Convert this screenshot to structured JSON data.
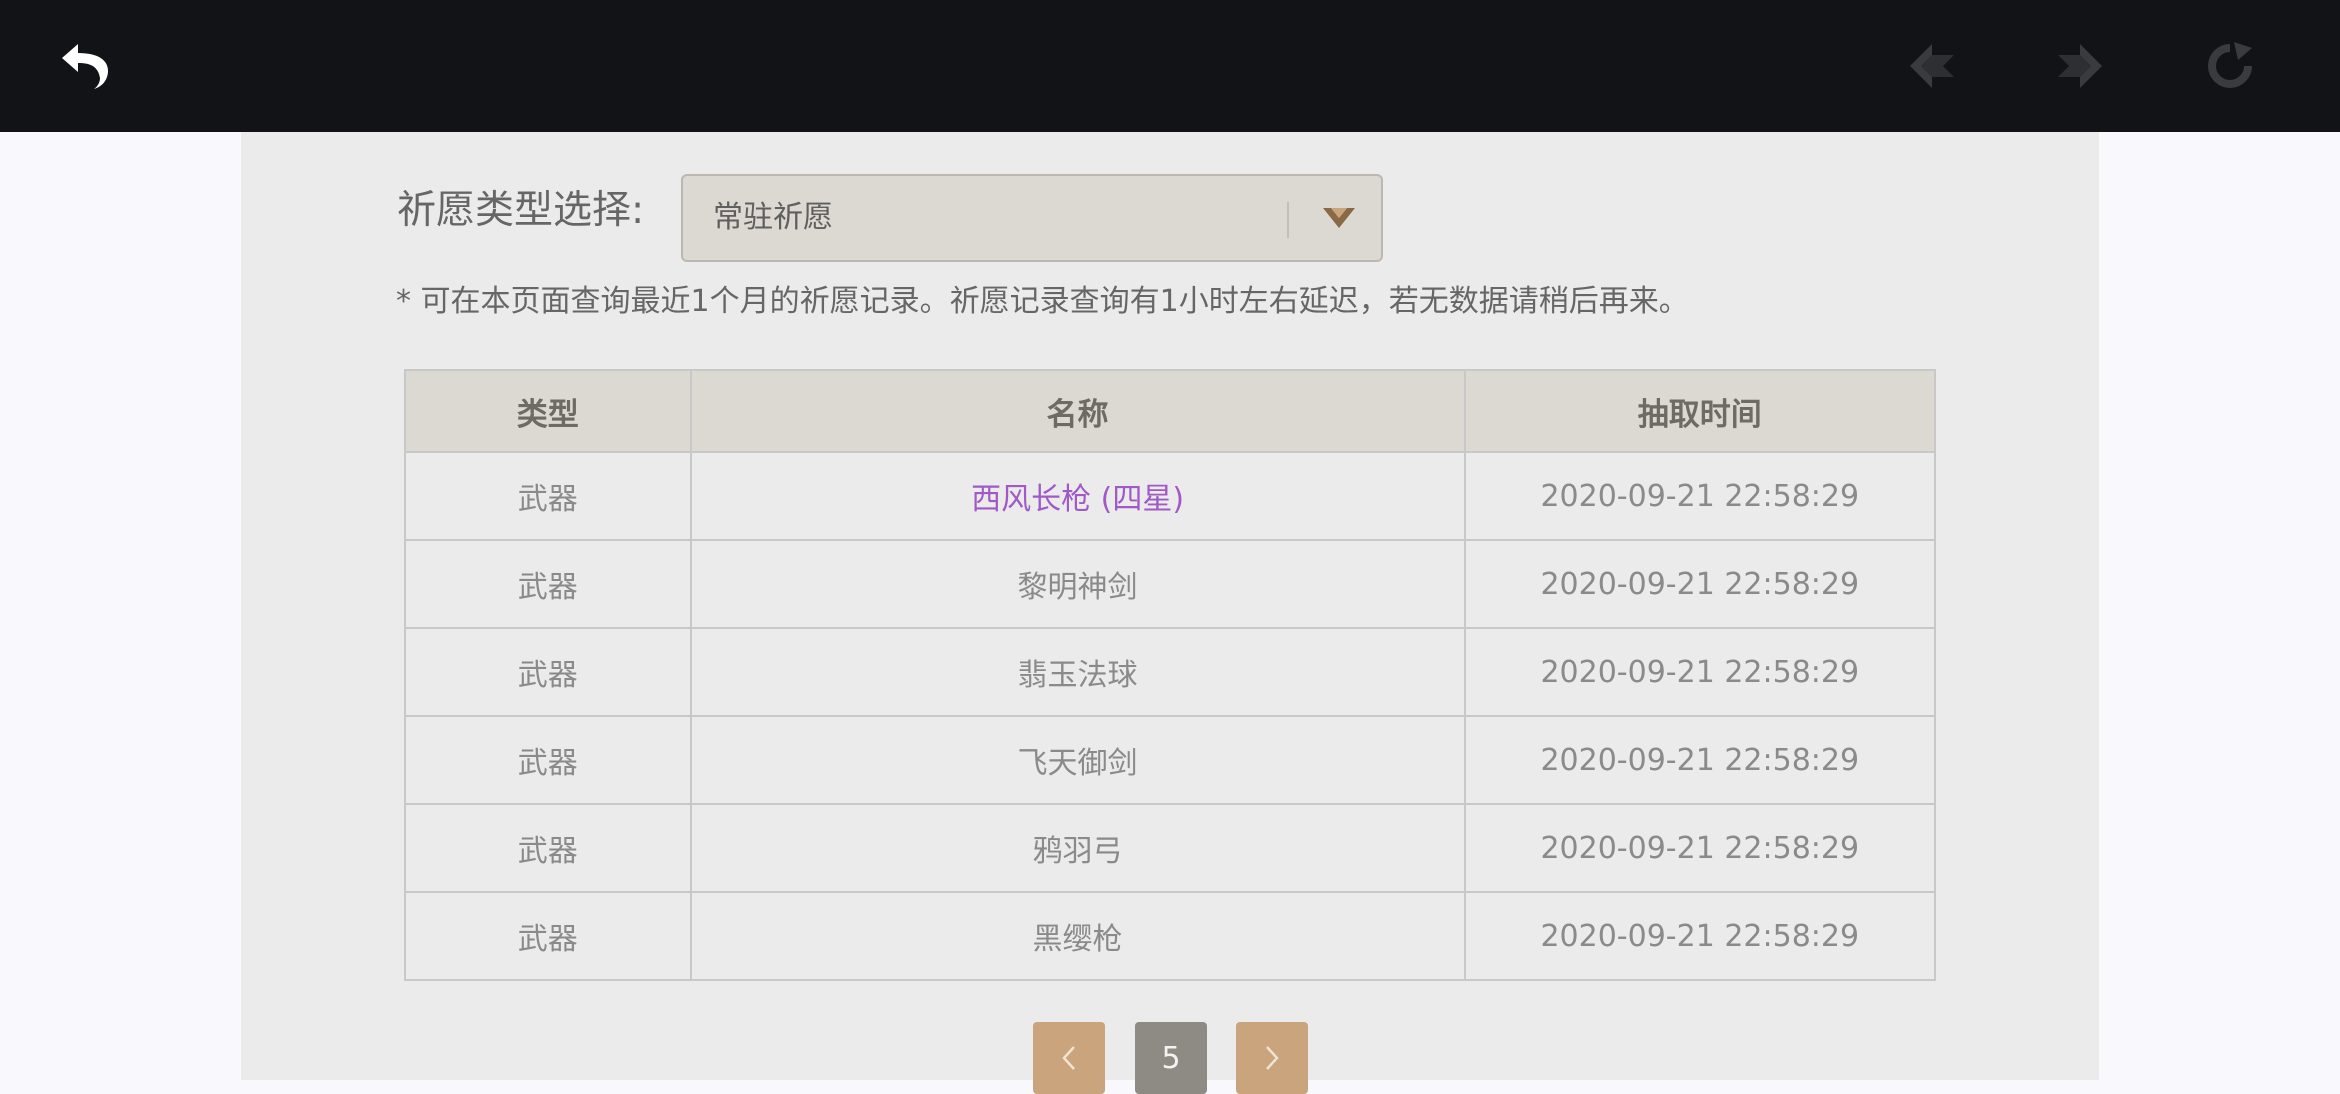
{
  "topbar": {
    "icons": [
      "back-arrow-icon",
      "prev-icon",
      "next-icon",
      "reload-icon"
    ],
    "colors": {
      "background": "#121316",
      "icon_active": "#ffffff",
      "icon_disabled": "#3a3b3f"
    }
  },
  "filter": {
    "label": "祈愿类型选择:",
    "selected": "常驻祈愿",
    "icon": "chevron-down-icon"
  },
  "notice": "* 可在本页面查询最近1个月的祈愿记录。祈愿记录查询有1小时左右延迟，若无数据请稍后再来。",
  "table": {
    "headers": [
      "类型",
      "名称",
      "抽取时间"
    ],
    "rows": [
      {
        "type": "武器",
        "name": "西风长枪 (四星)",
        "time": "2020-09-21 22:58:29",
        "highlight": "purple"
      },
      {
        "type": "武器",
        "name": "黎明神剑",
        "time": "2020-09-21 22:58:29"
      },
      {
        "type": "武器",
        "name": "翡玉法球",
        "time": "2020-09-21 22:58:29"
      },
      {
        "type": "武器",
        "name": "飞天御剑",
        "time": "2020-09-21 22:58:29"
      },
      {
        "type": "武器",
        "name": "鸦羽弓",
        "time": "2020-09-21 22:58:29"
      },
      {
        "type": "武器",
        "name": "黑缨枪",
        "time": "2020-09-21 22:58:29"
      }
    ],
    "colors": {
      "four_star": "#a05ac8"
    }
  },
  "pagination": {
    "current_page": "5",
    "prev_icon": "chevron-left-icon",
    "next_icon": "chevron-right-icon"
  }
}
